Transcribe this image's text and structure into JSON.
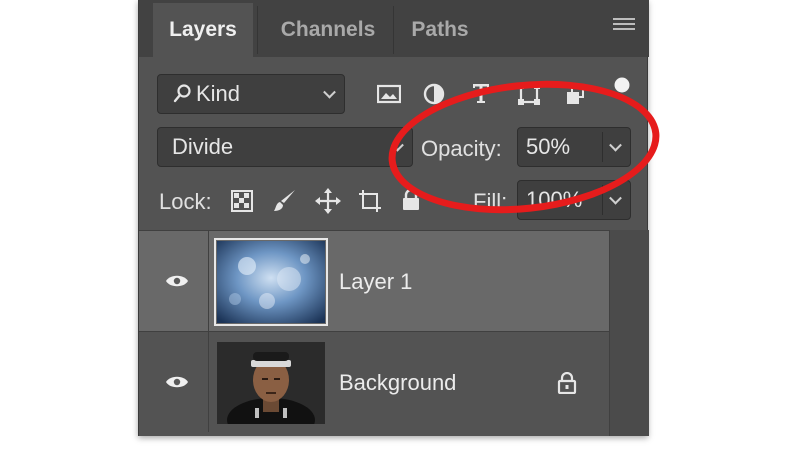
{
  "tabs": [
    {
      "label": "Layers",
      "active": true
    },
    {
      "label": "Channels",
      "active": false
    },
    {
      "label": "Paths",
      "active": false
    }
  ],
  "filter": {
    "kind_label": "Kind"
  },
  "blend": {
    "mode": "Divide",
    "opacity_label": "Opacity:",
    "opacity_value": "50%"
  },
  "lock": {
    "label": "Lock:",
    "fill_label": "Fill:",
    "fill_value": "100%"
  },
  "layers": [
    {
      "name": "Layer 1",
      "selected": true
    },
    {
      "name": "Background",
      "selected": false,
      "locked": true
    }
  ],
  "colors": {
    "panel": "#535353",
    "selected_row": "#696969",
    "annotation": "#e61c1c"
  }
}
